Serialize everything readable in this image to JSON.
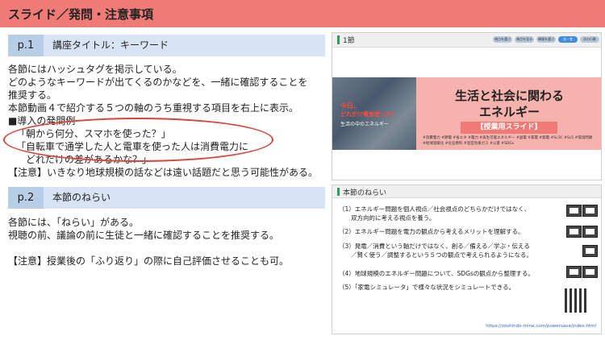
{
  "page_title": "スライド／発問・注意事項",
  "sections": [
    {
      "num": "p.1",
      "label": "講座タイトル：キーワード",
      "lines": [
        "各節にはハッシュタグを掲示している。",
        "どのようなキーワードが出てくるのかなどを、一緒に確認することを",
        "推奨する。",
        "本節動画４で紹介する５つの軸のうち重視する項目を右上に表示。",
        "■導入の発問例",
        "「朝から何分、スマホを使った？」",
        "「自転車で通学した人と電車を使った人は消費電力に",
        "　どれだけの差があるかな？」",
        "【注意】いきなり地球規模の話などは遠い話題だと思う可能性がある。"
      ]
    },
    {
      "num": "p.2",
      "label": "本節のねらい",
      "lines": [
        "各節には、「ねらい」がある。",
        "視聴の前、議論の前に生徒と一緒に確認することを推奨する。",
        "",
        "【注意】授業後の「ふり返り」の際に自己評価させることも可。"
      ]
    }
  ],
  "slide1": {
    "header": "1節",
    "tabs": [
      "視点を選ぶ",
      "視点を見る",
      "情報を選ぶ",
      "次・考",
      "次の行動"
    ],
    "photo_line1": "今日、",
    "photo_line2": "どれだけ電気使った？",
    "photo_line3": "生活の中のエネルギー",
    "main_line1": "生活と社会に関わる",
    "main_line2": "エネルギー",
    "badge": "【授業用スライド】",
    "tags": "#消費電力 #節電 #省エネ #電力 #再生可能エネルギー #送電 #家電 #発電 #Sc3C #Sc5 #環境問題 #地球温暖化 #化石燃料 #温室効果ガス #公害 #SDGs"
  },
  "slide2": {
    "header": "本節のねらい",
    "items": [
      "（1）エネルギー問題を個人視点／社会視点のどちらかだけではなく、",
      "　　双方向的に考える視点を養う。",
      "（2）エネルギー問題を電力の観点から考えるメリットを理解する。",
      "（3）発電／消費という軸だけではなく、創る／備える／学ぶ・伝える",
      "　　／賢く使う／調整するという５つの観点で考えられるようになる。",
      "（4）地球規模のエネルギー問題について、SDGsの観点から整理する。",
      "（5）「家電シミュレータ」で様々な状況をシミュレートできる。"
    ],
    "url": "https://zoshindo-mirai.com/powersave/index.html"
  }
}
